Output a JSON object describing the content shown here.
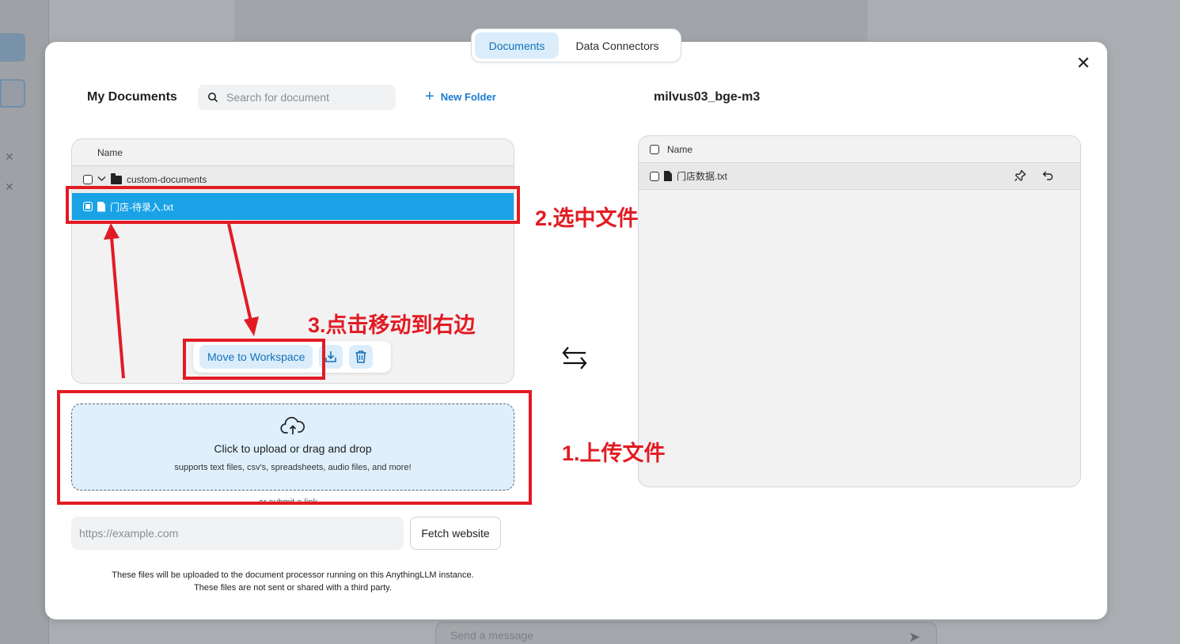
{
  "tabs": {
    "documents": "Documents",
    "data_connectors": "Data Connectors"
  },
  "my_documents": {
    "title": "My Documents",
    "search_placeholder": "Search for document",
    "new_folder": "New Folder",
    "column_name": "Name",
    "folder_name": "custom-documents",
    "selected_file": "门店-待录入.txt"
  },
  "actions": {
    "move_to_workspace": "Move to Workspace"
  },
  "upload": {
    "title": "Click to upload or drag and drop",
    "subtitle": "supports text files, csv's, spreadsheets, audio files, and more!",
    "submit_link": "or submit a link",
    "url_placeholder": "https://example.com",
    "fetch_button": "Fetch website",
    "disclaimer_line1": "These files will be uploaded to the document processor running on this AnythingLLM instance.",
    "disclaimer_line2": "These files are not sent or shared with a third party."
  },
  "workspace": {
    "title": "milvus03_bge-m3",
    "column_name": "Name",
    "file": "门店数据.txt"
  },
  "annotations": {
    "step1": "1.上传文件",
    "step2": "2.选中文件",
    "step3": "3.点击移动到右边"
  },
  "background": {
    "composer_placeholder": "Send a message"
  },
  "colors": {
    "accent_blue": "#1aa2e6",
    "annotation_red": "#e21b23",
    "button_bg": "#dbedfb"
  }
}
